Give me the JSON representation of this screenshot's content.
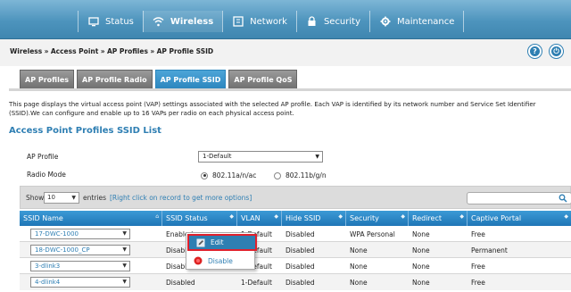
{
  "nav": {
    "items": [
      {
        "label": "Status",
        "icon": "monitor-icon"
      },
      {
        "label": "Wireless",
        "icon": "wifi-icon",
        "active": true
      },
      {
        "label": "Network",
        "icon": "network-icon"
      },
      {
        "label": "Security",
        "icon": "lock-icon"
      },
      {
        "label": "Maintenance",
        "icon": "gear-icon"
      }
    ]
  },
  "breadcrumb": {
    "wireless": "Wireless",
    "sep": "»",
    "access_point": "Access Point",
    "ap_profiles": "AP Profiles",
    "ap_profile_ssid": "AP Profile SSID"
  },
  "header_buttons": {
    "help": "?",
    "logout": "⏻"
  },
  "tabs": [
    "AP Profiles",
    "AP Profile Radio",
    "AP Profile SSID",
    "AP Profile QoS"
  ],
  "active_tab": "AP Profile SSID",
  "description": "This page displays the virtual access point (VAP) settings associated with the selected AP profile. Each VAP is identified by its network number and Service Set Identifier (SSID).We can configure and enable up to 16 VAPs per radio on each physical access point.",
  "list_title": "Access Point Profiles SSID List",
  "form": {
    "ap_profile_label": "AP Profile",
    "ap_profile_value": "1-Default",
    "radio_mode_label": "Radio Mode",
    "radio_a": "802.11a/n/ac",
    "radio_b": "802.11b/g/n",
    "selected_radio": "802.11a/n/ac"
  },
  "table_controls": {
    "show_label": "Show",
    "show_value": "10",
    "entries_label": "entries",
    "hint": "[Right click on record to get more options]"
  },
  "table": {
    "headers": [
      "SSID Name",
      "SSID Status",
      "VLAN",
      "Hide SSID",
      "Security",
      "Redirect",
      "Captive Portal"
    ],
    "rows": [
      {
        "ssid": "17-DWC-1000",
        "status": "Enabled",
        "vlan": "1-Default",
        "hide": "Disabled",
        "security": "WPA Personal",
        "redirect": "None",
        "portal": "Free"
      },
      {
        "ssid": "18-DWC-1000_CP",
        "status": "Disabled",
        "vlan": "1-Default",
        "hide": "Disabled",
        "security": "None",
        "redirect": "None",
        "portal": "Permanent"
      },
      {
        "ssid": "3-dlink3",
        "status": "Disabled",
        "vlan": "1-Default",
        "hide": "Disabled",
        "security": "None",
        "redirect": "None",
        "portal": "Free"
      },
      {
        "ssid": "4-dlink4",
        "status": "Disabled",
        "vlan": "1-Default",
        "hide": "Disabled",
        "security": "None",
        "redirect": "None",
        "portal": "Free"
      }
    ]
  },
  "context_menu": {
    "edit": "Edit",
    "disable": "Disable"
  },
  "colors": {
    "accent": "#2e7fb2",
    "highlight": "#e0202c"
  }
}
